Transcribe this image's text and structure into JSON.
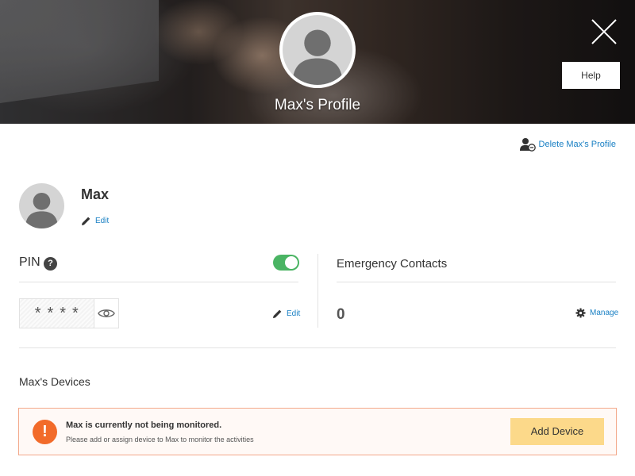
{
  "header": {
    "title": "Max's Profile",
    "help_label": "Help"
  },
  "actions": {
    "delete_label": "Delete Max's Profile"
  },
  "user": {
    "name": "Max",
    "edit_label": "Edit"
  },
  "pin": {
    "label": "PIN",
    "help_glyph": "?",
    "masked_value": "****",
    "enabled": true,
    "edit_label": "Edit"
  },
  "emergency": {
    "label": "Emergency Contacts",
    "count": "0",
    "manage_label": "Manage"
  },
  "devices": {
    "title": "Max's Devices",
    "alert_glyph": "!",
    "alert_title": "Max is currently not being monitored.",
    "alert_subtitle": "Please add or assign device to Max to monitor the activities",
    "add_button": "Add Device"
  },
  "colors": {
    "link": "#1a80c4",
    "toggle_on": "#4ab463",
    "warning": "#f26b2a",
    "add_button": "#fcd98a"
  },
  "icons": [
    "close-icon",
    "person-remove-icon",
    "pencil-icon",
    "eye-icon",
    "gear-icon",
    "help-icon",
    "warning-icon",
    "avatar-placeholder-icon"
  ]
}
